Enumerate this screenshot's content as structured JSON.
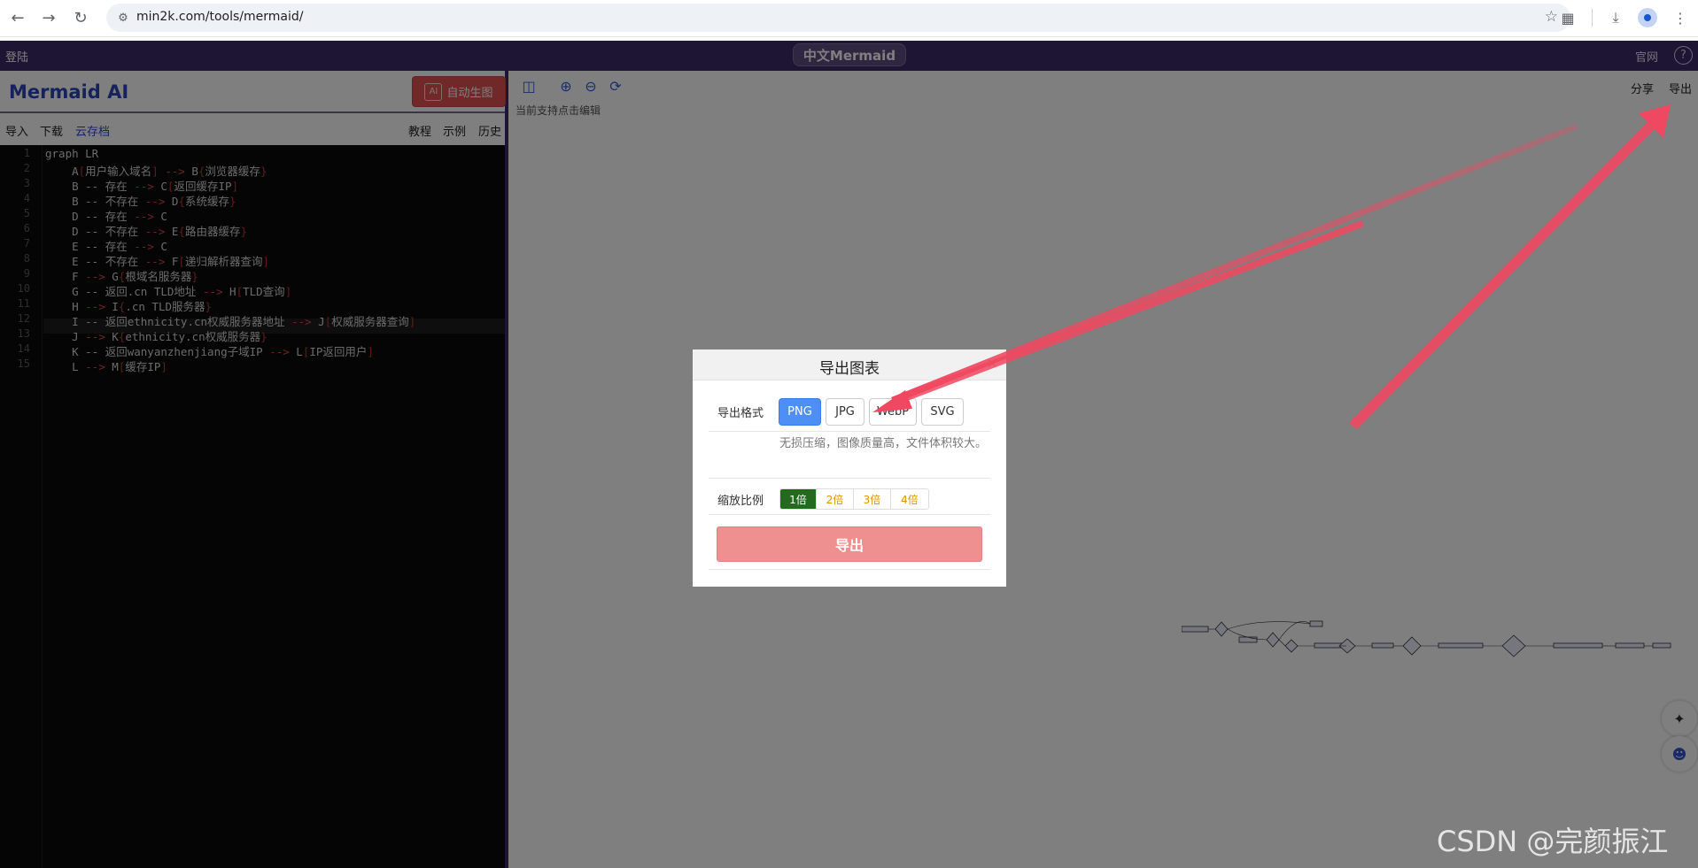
{
  "browser": {
    "url": "min2k.com/tools/mermaid/"
  },
  "appbar": {
    "login": "登陆",
    "title": "中文Mermaid",
    "official_site": "官网",
    "help": "?"
  },
  "left": {
    "brand": "Mermaid AI",
    "ai_button": "自动生图",
    "ai_chip": "AI",
    "toolbar_left": [
      "导入",
      "下载",
      "云存档"
    ],
    "toolbar_right": [
      "教程",
      "示例",
      "历史"
    ]
  },
  "editor": {
    "line_numbers": [
      "1",
      "2",
      "3",
      "4",
      "5",
      "6",
      "7",
      "8",
      "9",
      "10",
      "11",
      "12",
      "13",
      "14",
      "15"
    ],
    "lines": [
      [
        "graph LR"
      ],
      [
        "    A",
        "[",
        "用户输入域名",
        "]",
        " --> ",
        "B",
        "{",
        "浏览器缓存",
        "}"
      ],
      [
        "    B -- 存在 ",
        "-->",
        " C",
        "[",
        "返回缓存IP",
        "]"
      ],
      [
        "    B -- 不存在 ",
        "-->",
        " D",
        "{",
        "系统缓存",
        "}"
      ],
      [
        "    D -- 存在 ",
        "-->",
        " C"
      ],
      [
        "    D -- 不存在 ",
        "-->",
        " E",
        "{",
        "路由器缓存",
        "}"
      ],
      [
        "    E -- 存在 ",
        "-->",
        " C"
      ],
      [
        "    E -- 不存在 ",
        "-->",
        " F",
        "[",
        "递归解析器查询",
        "]"
      ],
      [
        "    F ",
        "-->",
        " G",
        "{",
        "根域名服务器",
        "}"
      ],
      [
        "    G -- 返回.cn TLD地址 ",
        "-->",
        " H",
        "[",
        "TLD查询",
        "]"
      ],
      [
        "    H ",
        "-->",
        " I",
        "{",
        ".cn TLD服务器",
        "}"
      ],
      [
        "    I -- 返回ethnicity.cn权威服务器地址 ",
        "-->",
        " J",
        "[",
        "权威服务器查询",
        "]"
      ],
      [
        "    J ",
        "-->",
        " K",
        "{",
        "ethnicity.cn权威服务器",
        "}"
      ],
      [
        "    K -- 返回wanyanzhenjiang子域IP ",
        "-->",
        " L",
        "[",
        "IP返回用户",
        "]"
      ],
      [
        "    L ",
        "-->",
        " M",
        "[",
        "缓存IP",
        "]"
      ]
    ]
  },
  "right": {
    "hint": "当前支持点击编辑",
    "share": "分享",
    "export": "导出"
  },
  "modal": {
    "title": "导出图表",
    "close": "×",
    "format_label": "导出格式",
    "formats": [
      "PNG",
      "JPG",
      "WebP",
      "SVG"
    ],
    "selected_format": "PNG",
    "format_desc": "无损压缩，图像质量高，文件体积较大。",
    "scale_label": "缩放比例",
    "scales": [
      "1倍",
      "2倍",
      "3倍",
      "4倍"
    ],
    "selected_scale": "1倍",
    "export_button": "导出"
  },
  "watermark": "CSDN @完颜振江",
  "colors": {
    "appbar": "#3a2a67",
    "brand": "#2a45b8",
    "ai_button": "#e05050",
    "format_selected": "#4d8ff5",
    "scale_selected": "#236a1e",
    "export_button": "#ef9090",
    "annotation_arrow": "#f04860"
  }
}
